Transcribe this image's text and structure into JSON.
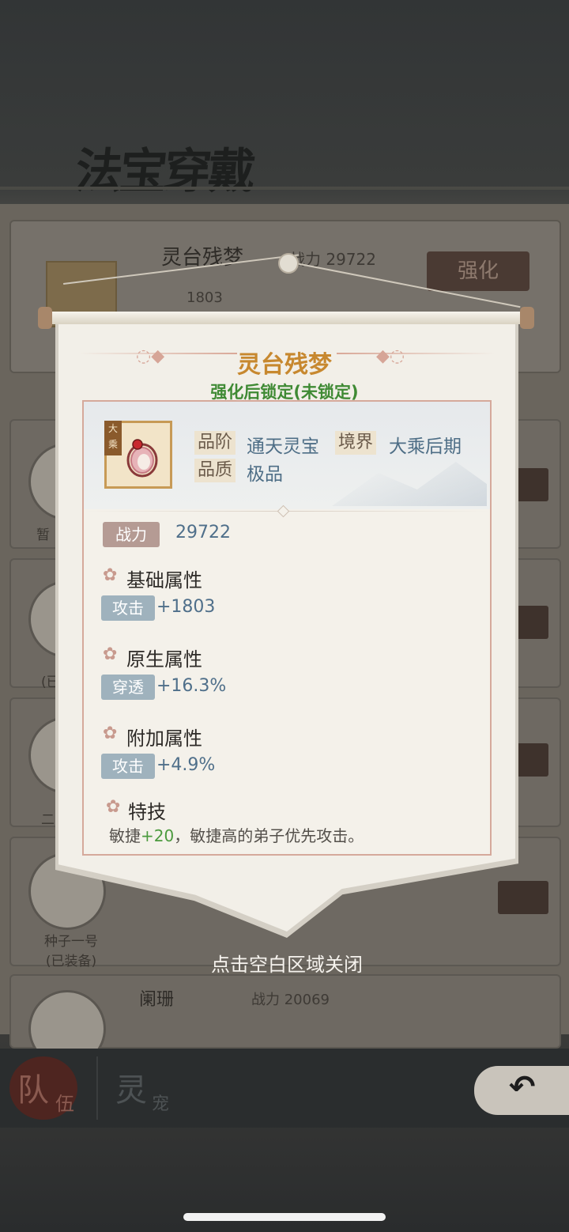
{
  "background": {
    "title": "法宝穿戴",
    "top_card": {
      "name": "灵台残梦",
      "power_label": "战力",
      "power_value": "29722",
      "stat_value": "1803",
      "button": "强化"
    },
    "rows": [
      {
        "label": "暂"
      },
      {
        "label": "(已"
      },
      {
        "label": "二\n(已"
      },
      {
        "label": "种子一号",
        "sub": "(已装备)"
      }
    ],
    "bottom_row": {
      "name": "阑珊",
      "power_label": "战力",
      "power_value": "20069"
    }
  },
  "nav": {
    "team_main": "队",
    "team_sub": "伍",
    "pet_main": "灵",
    "pet_sub": "宠",
    "back_icon": "arrow-back-icon"
  },
  "popup": {
    "title": "灵台残梦",
    "lock_status": "强化后锁定(未锁定)",
    "item_tag": "大乘",
    "grade_label": "品阶",
    "grade_value": "通天灵宝",
    "realm_label": "境界",
    "realm_value": "大乘后期",
    "quality_label": "品质",
    "quality_value": "极品",
    "power_label": "战力",
    "power_value": "29722",
    "sections": [
      {
        "title": "基础属性",
        "stat_label": "攻击",
        "stat_value": "+1803"
      },
      {
        "title": "原生属性",
        "stat_label": "穿透",
        "stat_value": "+16.3%"
      },
      {
        "title": "附加属性",
        "stat_label": "攻击",
        "stat_value": "+4.9%"
      }
    ],
    "skill_title": "特技",
    "skill_prefix": "敏捷",
    "skill_bonus": "+20",
    "skill_suffix": "，敏捷高的弟子优先攻击。"
  },
  "close_hint": "点击空白区域关闭",
  "colors": {
    "title_gold": "#c7882f",
    "lock_green": "#3f8a34",
    "value_blue": "#4f6f8a",
    "frame_rose": "#d5a99b"
  }
}
